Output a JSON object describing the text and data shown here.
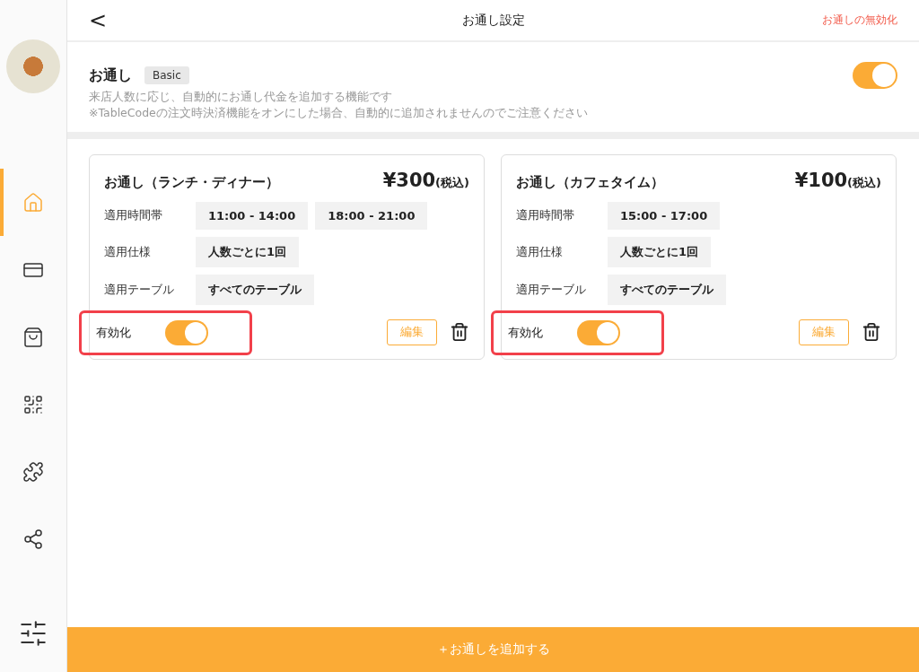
{
  "header": {
    "back": "<",
    "title": "お通し設定",
    "action": "お通しの無効化"
  },
  "sidebar": {
    "items": [
      {
        "kind": "home",
        "selected": true
      },
      {
        "kind": "card",
        "selected": false
      },
      {
        "kind": "bag",
        "selected": false
      },
      {
        "kind": "qr",
        "selected": false
      },
      {
        "kind": "puzzle",
        "selected": false
      },
      {
        "kind": "network",
        "selected": false
      }
    ]
  },
  "feature": {
    "title": "お通し",
    "badge": "Basic",
    "on": true,
    "description": [
      "来店人数に応じ、自動的にお通し代金を追加する機能です",
      "※TableCodeの注文時決済機能をオンにした場合、自動的に追加されませんのでご注意ください"
    ]
  },
  "cards": [
    {
      "title": "お通し（ランチ・ディナー）",
      "price": "¥300",
      "tax_note": "(税込)",
      "rows": [
        {
          "label": "適用時間帯",
          "values": [
            "11:00 - 14:00",
            "18:00 - 21:00"
          ]
        },
        {
          "label": "適用仕様",
          "values": [
            "人数ごとに1回"
          ]
        },
        {
          "label": "適用テーブル",
          "values": [
            "すべてのテーブル"
          ]
        }
      ],
      "enabled_label": "有効化",
      "enabled": true,
      "highlighted": true,
      "edit": "編集"
    },
    {
      "title": "お通し（カフェタイム）",
      "price": "¥100",
      "tax_note": "(税込)",
      "rows": [
        {
          "label": "適用時間帯",
          "values": [
            "15:00 - 17:00"
          ]
        },
        {
          "label": "適用仕様",
          "values": [
            "人数ごとに1回"
          ]
        },
        {
          "label": "適用テーブル",
          "values": [
            "すべてのテーブル"
          ]
        }
      ],
      "enabled_label": "有効化",
      "enabled": true,
      "highlighted": true,
      "edit": "編集"
    }
  ],
  "add_button": "＋お通しを追加する"
}
